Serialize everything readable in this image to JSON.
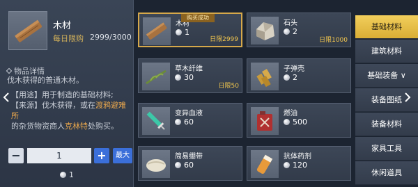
{
  "selected_item": {
    "name": "木材",
    "limit_label": "每日限购",
    "limit_value": "2999/3000",
    "icon": "wood-plank-icon",
    "detail_title": "物品详情",
    "detail_desc": "伐木获得的普通木材。",
    "usage_line1": "【用途】用于制造的基础材料;",
    "usage_line2_pre": "【来源】伐木获得，或在",
    "usage_line2_hl": "渡鸦避难所",
    "usage_line3_pre": "的杂货物资商人",
    "usage_line3_hl": "克林特",
    "usage_line3_post": "处购买。"
  },
  "quantity": {
    "minus": "−",
    "value": "1",
    "plus": "+",
    "max_label": "最大"
  },
  "total_cost": "1",
  "items": [
    {
      "name": "木材",
      "price": "1",
      "limit": "日限2999",
      "icon": "wood-plank-icon",
      "badge": "购买成功",
      "selected": true
    },
    {
      "name": "石头",
      "price": "2",
      "limit": "日限1000",
      "icon": "stone-icon"
    },
    {
      "name": "草木纤维",
      "price": "30",
      "limit": "日限50",
      "icon": "plant-fiber-icon"
    },
    {
      "name": "子弹壳",
      "price": "2",
      "limit": "",
      "icon": "bullet-shell-icon"
    },
    {
      "name": "变异血液",
      "price": "60",
      "limit": "",
      "icon": "syringe-icon"
    },
    {
      "name": "燃油",
      "price": "500",
      "limit": "",
      "icon": "fuel-can-icon"
    },
    {
      "name": "简易绷带",
      "price": "60",
      "limit": "",
      "icon": "bandage-icon"
    },
    {
      "name": "抗体药剂",
      "price": "120",
      "limit": "",
      "icon": "antibody-potion-icon"
    }
  ],
  "tabs": [
    {
      "label": "基础材料",
      "active": true
    },
    {
      "label": "建筑材料"
    },
    {
      "label": "基础装备 ∨"
    },
    {
      "label": "装备图纸"
    },
    {
      "label": "装备材料"
    },
    {
      "label": "家具工具"
    },
    {
      "label": "休闲道具"
    }
  ],
  "colors": {
    "accent_gold": "#d9ae35",
    "highlight_orange": "#e8a64c",
    "button_blue": "#3b6fd9",
    "limit_yellow": "#f2c64e"
  }
}
